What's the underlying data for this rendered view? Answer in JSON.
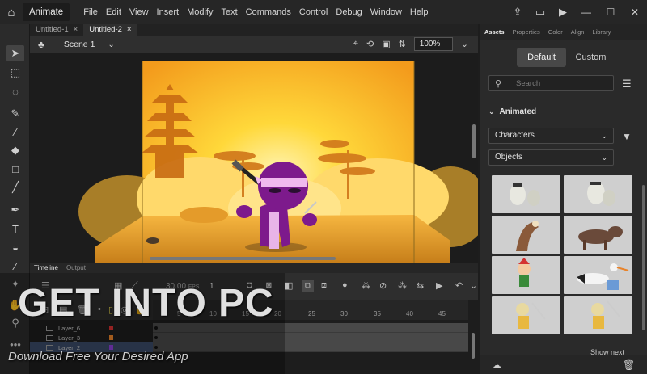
{
  "app": {
    "name": "Animate",
    "menu": [
      "File",
      "Edit",
      "View",
      "Insert",
      "Modify",
      "Text",
      "Commands",
      "Control",
      "Debug",
      "Window",
      "Help"
    ]
  },
  "doc_tabs": [
    {
      "label": "Untitled-1",
      "active": false
    },
    {
      "label": "Untitled-2",
      "active": true
    }
  ],
  "scene": {
    "name": "Scene 1",
    "zoom": "100%"
  },
  "timeline": {
    "tabs": [
      "Timeline",
      "Output"
    ],
    "fps": "30.00",
    "fps_unit": "FPS",
    "frame": "1",
    "ruler": [
      "5",
      "10",
      "15",
      "20",
      "25",
      "30",
      "35",
      "40",
      "45"
    ],
    "layers": [
      {
        "name": "Layer_6",
        "color": "#d43232",
        "selected": false
      },
      {
        "name": "Layer_3",
        "color": "#e8832a",
        "selected": false
      },
      {
        "name": "Layer_2",
        "color": "#8a3fd6",
        "selected": true
      }
    ]
  },
  "assets": {
    "tabs": [
      "Assets",
      "Properties",
      "Color",
      "Align",
      "Library"
    ],
    "mode_default": "Default",
    "mode_custom": "Custom",
    "search_placeholder": "Search",
    "section": "Animated",
    "category": "Characters",
    "subcategory": "Objects",
    "show_next": "Show next"
  },
  "watermark": {
    "title": "GET INTO PC",
    "subtitle": "Download Free Your Desired App"
  },
  "colors": {
    "stage_sky_top": "#ffd83a",
    "stage_sky_bottom": "#f39b1c",
    "ninja_purple": "#7d1a8c",
    "accent_selection": "#3a4a66"
  }
}
